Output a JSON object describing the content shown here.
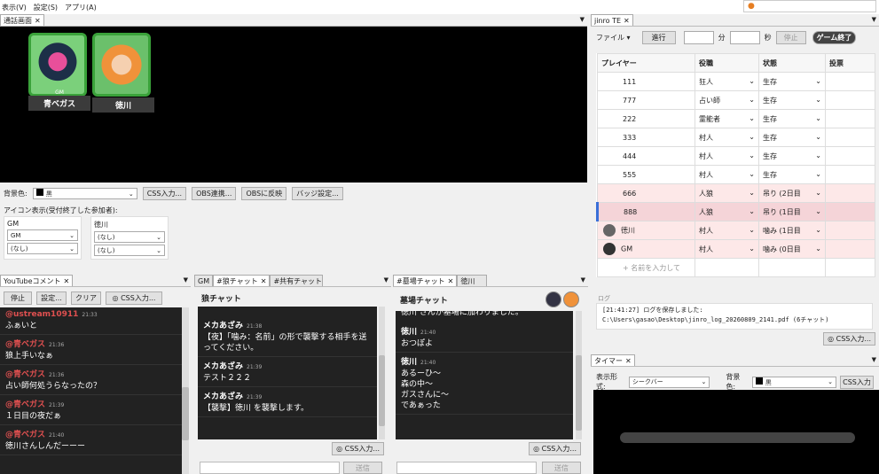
{
  "menu": {
    "items": [
      "表示(V)",
      "設定(S)",
      "アプリ(A)"
    ]
  },
  "call_panel": {
    "tab": "通話画面",
    "members": [
      {
        "badge": "GM",
        "name": "青ベガス"
      },
      {
        "badge": "",
        "name": "徳川"
      }
    ],
    "bg_label": "背景色:",
    "bg_value": "黒",
    "buttons": [
      "CSS入力...",
      "OBS連携...",
      "OBSに反映",
      "バッジ設定..."
    ],
    "icon_label": "アイコン表示(受付終了した参加者):",
    "icon_groups": [
      {
        "title": "GM",
        "sel1": "GM",
        "sel2": "(なし)"
      },
      {
        "title": "徳川",
        "sel1": "(なし)",
        "sel2": "(なし)"
      }
    ]
  },
  "youtube": {
    "tab": "YouTubeコメント",
    "buttons": [
      "停止",
      "設定...",
      "クリア",
      "CSS入力..."
    ],
    "messages": [
      {
        "name": "@ustream10911",
        "time": "21:33",
        "text": "ふぁいと"
      },
      {
        "name": "@青ベガス",
        "time": "21:36",
        "text": "狼上手いなぁ"
      },
      {
        "name": "@青ベガス",
        "time": "21:36",
        "text": "占い師何処うらなったの？"
      },
      {
        "name": "@青ベガス",
        "time": "21:39",
        "text": "１日目の夜だぁ"
      },
      {
        "name": "@青ベガス",
        "time": "21:40",
        "text": "徳川さんしんだーーー"
      }
    ]
  },
  "wolf": {
    "tabs": [
      "GM",
      "#狼チャット",
      "#共有チャット"
    ],
    "title": "狼チャット",
    "messages": [
      {
        "name": "メカあざみ",
        "time": "21:38",
        "text": "【夜】「噛み：名前」の形で襲撃する相手を送ってください。"
      },
      {
        "name": "メカあざみ",
        "time": "21:39",
        "text": "テスト２２２"
      },
      {
        "name": "メカあざみ",
        "time": "21:39",
        "text": "【襲撃】徳川 を襲撃します。"
      }
    ],
    "css": "CSS入力...",
    "send": "送信"
  },
  "grave": {
    "tabs": [
      "#墓場チャット",
      "徳川"
    ],
    "title": "墓場チャット",
    "top_text": "徳川 さんが墓場に加わりました。",
    "messages": [
      {
        "name": "徳川",
        "time": "21:40",
        "text": "おつぽよ"
      },
      {
        "name": "徳川",
        "time": "21:40",
        "text": "あるーひ〜\n森の中〜\nガスさんに〜\nであぁった"
      }
    ],
    "css": "CSS入力...",
    "send": "送信"
  },
  "jinro": {
    "tab": "jinro TE",
    "file": "ファイル",
    "advance": "進行",
    "min": "分",
    "sec": "秒",
    "stop": "停止",
    "end": "ゲーム終了",
    "headers": [
      "プレイヤー",
      "役職",
      "状態",
      "投票"
    ],
    "rows": [
      {
        "name": "111",
        "role": "狂人",
        "state": "生存",
        "vote": ""
      },
      {
        "name": "777",
        "role": "占い師",
        "state": "生存",
        "vote": ""
      },
      {
        "name": "222",
        "role": "霊能者",
        "state": "生存",
        "vote": ""
      },
      {
        "name": "333",
        "role": "村人",
        "state": "生存",
        "vote": ""
      },
      {
        "name": "444",
        "role": "村人",
        "state": "生存",
        "vote": ""
      },
      {
        "name": "555",
        "role": "村人",
        "state": "生存",
        "vote": ""
      },
      {
        "name": "666",
        "role": "人狼",
        "state": "吊り (2日目",
        "vote": ""
      },
      {
        "name": "888",
        "role": "人狼",
        "state": "吊り (1日目",
        "vote": ""
      },
      {
        "name": "徳川",
        "role": "村人",
        "state": "噛み (1日目",
        "vote": ""
      },
      {
        "name": "GM",
        "role": "村人",
        "state": "噛み (0日目",
        "vote": ""
      }
    ],
    "add_placeholder": "+ 名前を入力して",
    "log_label": "ログ",
    "log_text": "[21:41:27] ログを保存しました: C:\\Users\\gasao\\Desktop\\jinro_log_20260809_2141.pdf (6チャット)",
    "css": "CSS入力..."
  },
  "timer": {
    "tab": "タイマー",
    "format_label": "表示形式:",
    "format_value": "シークバー",
    "bg_label": "背景色:",
    "bg_value": "黒",
    "css": "CSS入力"
  },
  "colors": {
    "accent_green": "#3aa23a",
    "name_red": "#e05050",
    "dead_row": "#fde8e8"
  }
}
